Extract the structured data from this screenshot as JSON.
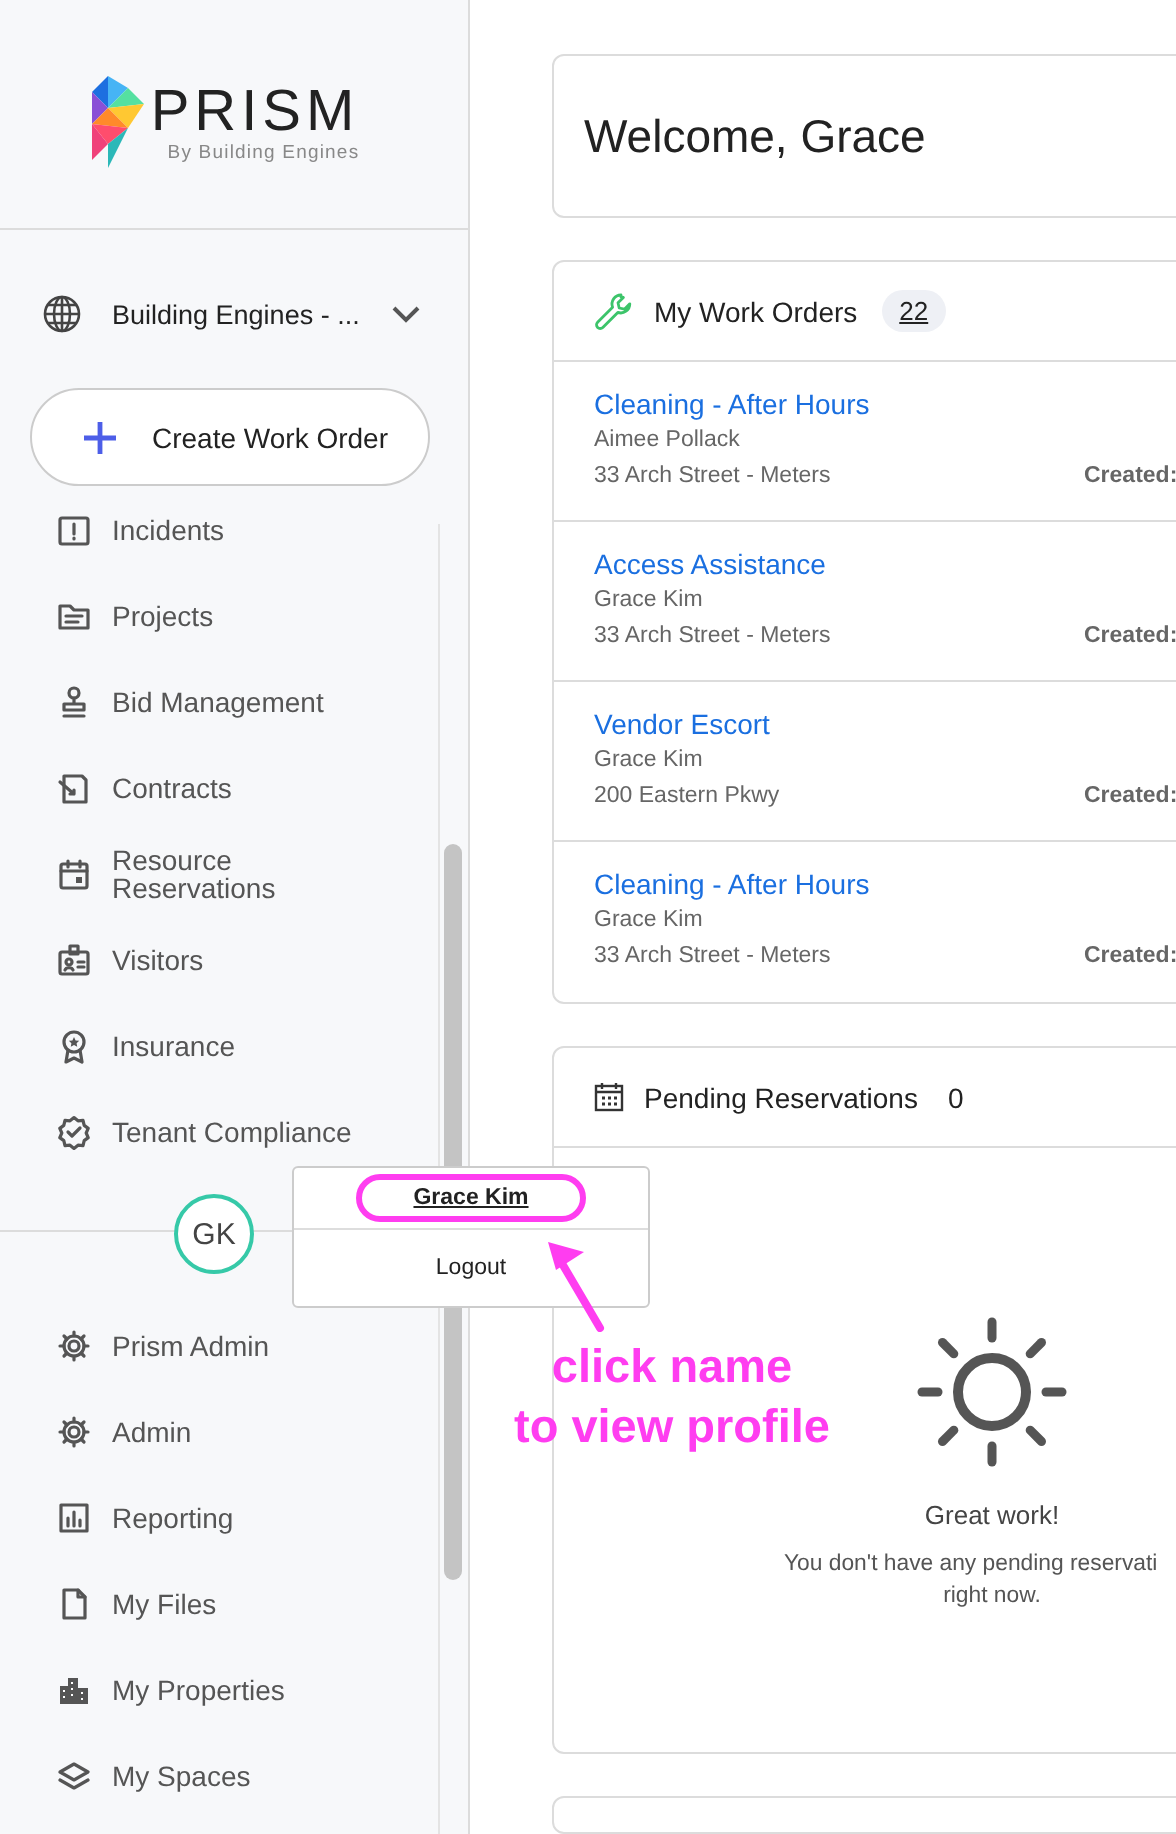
{
  "logo": {
    "name": "PRISM",
    "tagline": "By Building Engines"
  },
  "property_selector": {
    "value": "Building Engines - ..."
  },
  "create_button": {
    "label": "Create Work Order"
  },
  "nav_items_upper": [
    {
      "label": "Incidents"
    },
    {
      "label": "Projects"
    },
    {
      "label": "Bid Management"
    },
    {
      "label": "Contracts"
    },
    {
      "label": "Resource Reservations"
    },
    {
      "label": "Visitors"
    },
    {
      "label": "Insurance"
    },
    {
      "label": "Tenant Compliance"
    }
  ],
  "user": {
    "initials": "GK"
  },
  "user_menu": {
    "items": [
      {
        "label": "Grace Kim",
        "highlighted": true
      },
      {
        "label": "Logout",
        "highlighted": false
      }
    ]
  },
  "nav_items_lower": [
    {
      "label": "Prism Admin"
    },
    {
      "label": "Admin"
    },
    {
      "label": "Reporting"
    },
    {
      "label": "My Files"
    },
    {
      "label": "My Properties"
    },
    {
      "label": "My Spaces"
    }
  ],
  "welcome": {
    "title": "Welcome, Grace"
  },
  "work_orders": {
    "title": "My Work Orders",
    "count": "22",
    "rows": [
      {
        "title": "Cleaning - After Hours",
        "requester": "Aimee Pollack",
        "location": "33 Arch Street - Meters",
        "created_label": "Created:"
      },
      {
        "title": "Access Assistance",
        "requester": "Grace Kim",
        "location": "33 Arch Street - Meters",
        "created_label": "Created:"
      },
      {
        "title": "Vendor Escort",
        "requester": "Grace Kim",
        "location": "200 Eastern Pkwy",
        "created_label": "Created:"
      },
      {
        "title": "Cleaning - After Hours",
        "requester": "Grace Kim",
        "location": "33 Arch Street - Meters",
        "created_label": "Created:"
      }
    ]
  },
  "pending_reservations": {
    "title": "Pending Reservations",
    "count": "0",
    "empty_title": "Great work!",
    "empty_message": [
      "You don't have any pending reservati",
      "right now."
    ]
  },
  "annotation": {
    "lines": [
      "click name",
      "to view profile"
    ]
  }
}
